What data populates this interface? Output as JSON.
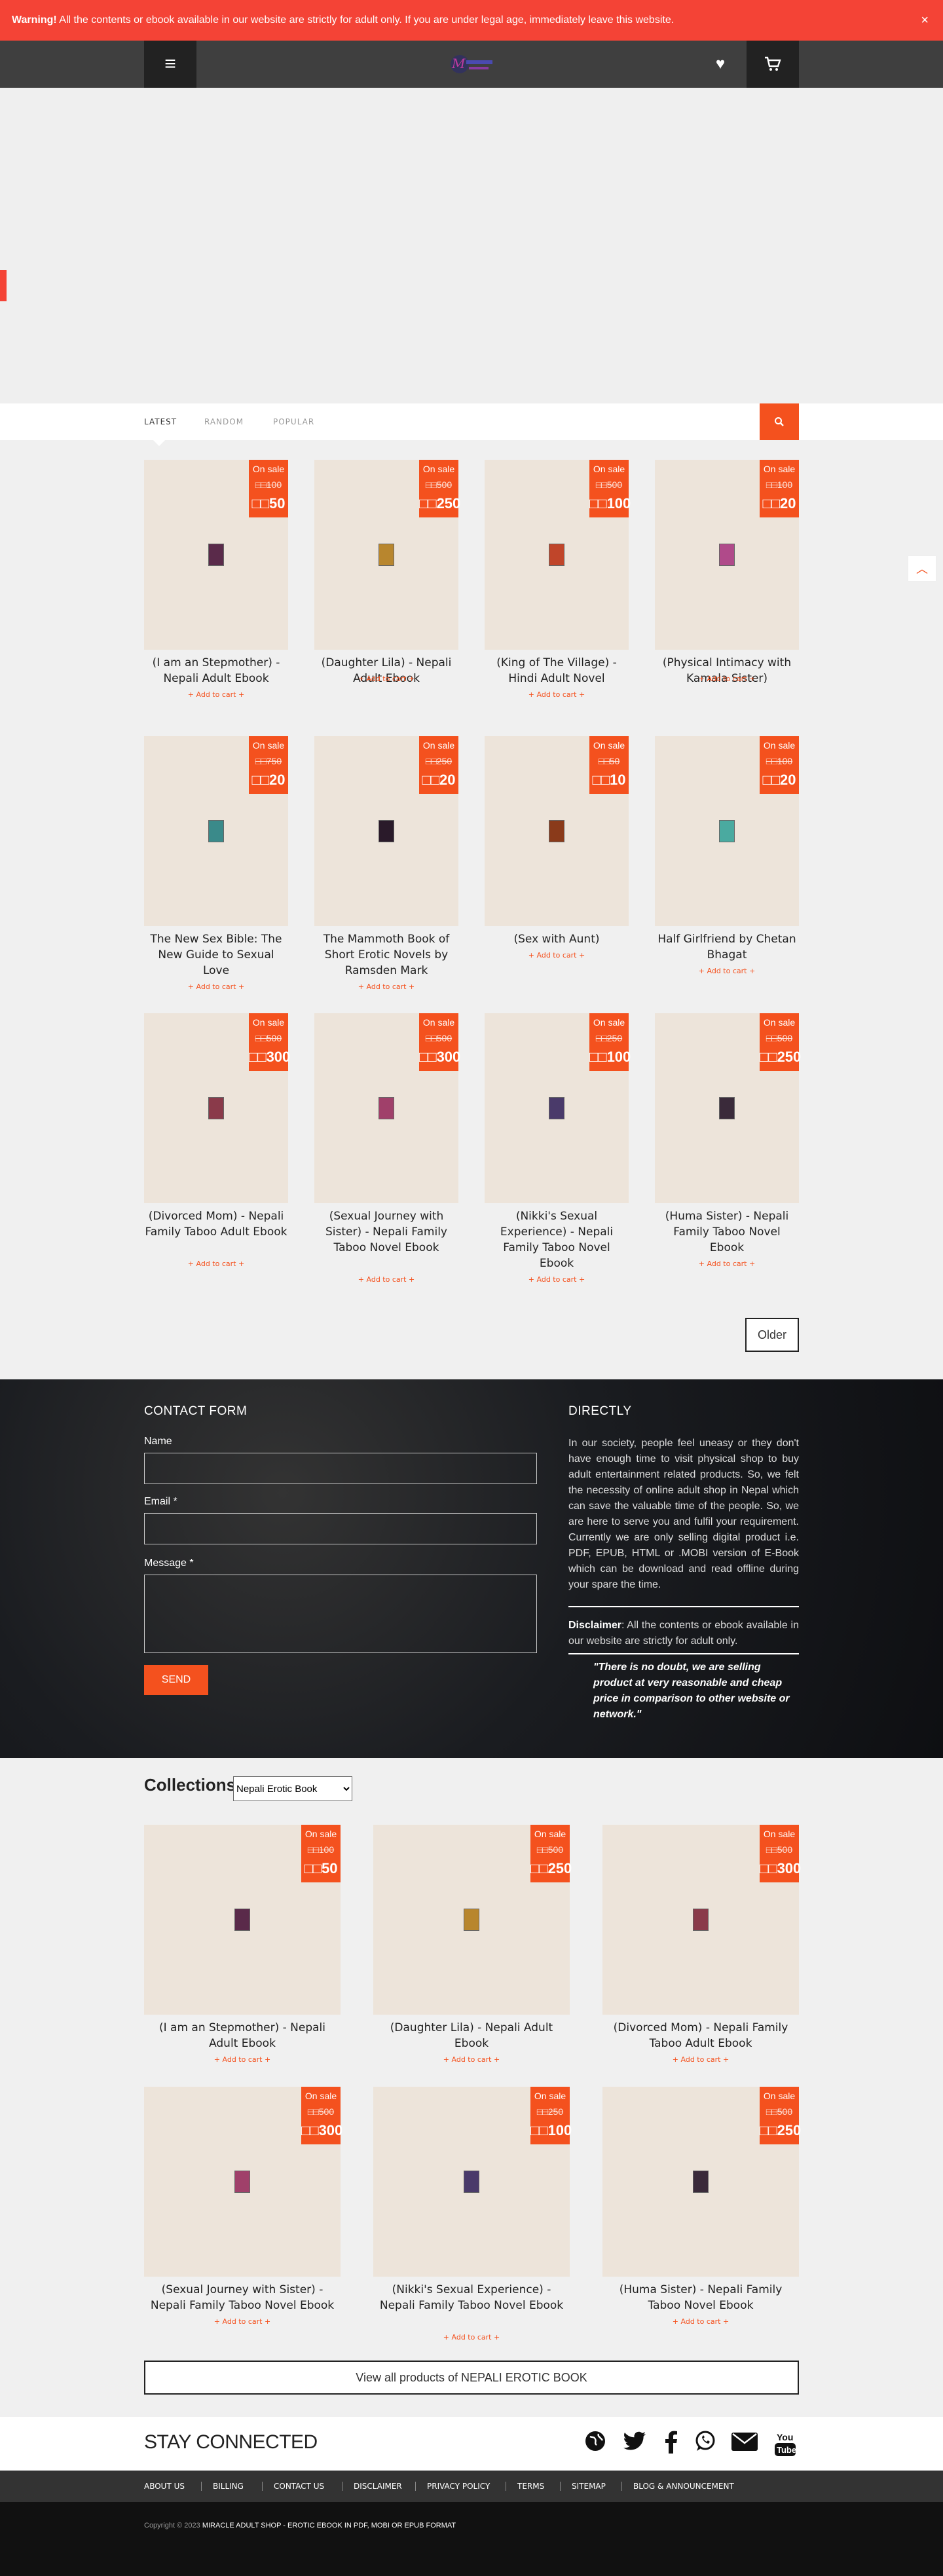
{
  "warning": {
    "bold": "Warning!",
    "text": "All the contents or ebook available in our website are strictly for adult only. If you are under legal age, immediately leave this website.",
    "close": "×"
  },
  "nav": {
    "menu_icon": "menu-icon",
    "heart_icon": "heart-icon",
    "cart_icon": "cart-icon"
  },
  "tabs": {
    "latest": "LATEST",
    "random": "RANDOM",
    "popular": "POPULAR"
  },
  "sale_label": "On sale",
  "add_to_cart": "+ Add to cart +",
  "products": [
    {
      "title": "(I am an Stepmother) - Nepali Adult Ebook",
      "old": "□□100",
      "new": "□□50",
      "cover": "#5a2a4a"
    },
    {
      "title": "(Daughter Lila) - Nepali Adult Ebook",
      "old": "□□500",
      "new": "□□250",
      "cover": "#b8862e"
    },
    {
      "title": "(King of The Village) - Hindi Adult Novel",
      "old": "□□500",
      "new": "□□100",
      "cover": "#c0452a"
    },
    {
      "title": "(Physical Intimacy with Kamala Sister)",
      "old": "□□100",
      "new": "□□20",
      "cover": "#b04a8a"
    },
    {
      "title": "The New Sex Bible: The New Guide to Sexual Love",
      "old": "□□750",
      "new": "□□20",
      "cover": "#3a8a8a"
    },
    {
      "title": "The Mammoth Book of Short Erotic Novels by Ramsden Mark",
      "old": "□□250",
      "new": "□□20",
      "cover": "#2a1a2a"
    },
    {
      "title": "(Sex with Aunt)",
      "old": "□□50",
      "new": "□□10",
      "cover": "#8a3a1a"
    },
    {
      "title": "Half Girlfriend by Chetan Bhagat",
      "old": "□□100",
      "new": "□□20",
      "cover": "#4aaaa0"
    },
    {
      "title": "(Divorced Mom) - Nepali Family Taboo Adult Ebook",
      "old": "□□500",
      "new": "□□300",
      "cover": "#8a3a4a"
    },
    {
      "title": "(Sexual Journey with Sister) - Nepali Family Taboo Novel Ebook",
      "old": "□□500",
      "new": "□□300",
      "cover": "#a0406a"
    },
    {
      "title": "(Nikki's Sexual Experience) - Nepali Family Taboo Novel Ebook",
      "old": "□□250",
      "new": "□□100",
      "cover": "#4a3a6a"
    },
    {
      "title": "(Huma Sister) - Nepali Family Taboo Novel Ebook",
      "old": "□□500",
      "new": "□□250",
      "cover": "#3a2a3a"
    }
  ],
  "older": "Older",
  "contact": {
    "heading": "CONTACT FORM",
    "name_label": "Name",
    "email_label": "Email *",
    "message_label": "Message *",
    "send": "SEND"
  },
  "directly": {
    "heading": "DIRECTLY",
    "body": "In our society, people feel uneasy or they don't have enough time to visit physical shop to buy adult entertainment related products. So, we felt the necessity of online adult shop in Nepal which can save the valuable time of the people. So, we are here to serve you and fulfil your requirement. Currently we are only selling digital product i.e. PDF, EPUB, HTML or .MOBI version of E-Book which can be download and read offline during your spare the time.",
    "disclaimer_bold": "Disclaimer",
    "disclaimer": ": All the contents or ebook available in our website are strictly for adult only.",
    "quote": "\"There is no doubt, we are selling product at very reasonable and cheap price in comparison to other website or network.\""
  },
  "collections": {
    "heading": "Collections",
    "selected": "Nepali Erotic Book",
    "items": [
      {
        "title": "(I am an Stepmother) - Nepali Adult Ebook",
        "old": "□□100",
        "new": "□□50",
        "cover": "#5a2a4a"
      },
      {
        "title": "(Daughter Lila) - Nepali Adult Ebook",
        "old": "□□500",
        "new": "□□250",
        "cover": "#b8862e"
      },
      {
        "title": "(Divorced Mom) - Nepali Family Taboo Adult Ebook",
        "old": "□□500",
        "new": "□□300",
        "cover": "#8a3a4a"
      },
      {
        "title": "(Sexual Journey with Sister) - Nepali Family Taboo Novel Ebook",
        "old": "□□500",
        "new": "□□300",
        "cover": "#a0406a"
      },
      {
        "title": "(Nikki's Sexual Experience) - Nepali Family Taboo Novel Ebook",
        "old": "□□250",
        "new": "□□100",
        "cover": "#4a3a6a"
      },
      {
        "title": "(Huma Sister) - Nepali Family Taboo Novel Ebook",
        "old": "□□500",
        "new": "□□250",
        "cover": "#3a2a3a"
      }
    ],
    "view_all": "View all products of NEPALI EROTIC BOOK"
  },
  "stay": {
    "heading": "STAY CONNECTED",
    "icons": [
      "globe-icon",
      "twitter-icon",
      "facebook-icon",
      "whatsapp-icon",
      "email-icon",
      "youtube-icon"
    ]
  },
  "footer_links": [
    "ABOUT US",
    "BILLING",
    "CONTACT US",
    "DISCLAIMER",
    "PRIVACY POLICY",
    "TERMS",
    "SITEMAP",
    "BLOG & ANNOUNCEMENT"
  ],
  "copyright": {
    "prefix": "Copyright © 2023",
    "site": "MIRACLE ADULT SHOP - EROTIC EBOOK IN PDF, MOBI OR EPUB FORMAT"
  },
  "colors": {
    "accent": "#f4511e",
    "warning": "#f44336",
    "nav": "#3f3f3f"
  }
}
